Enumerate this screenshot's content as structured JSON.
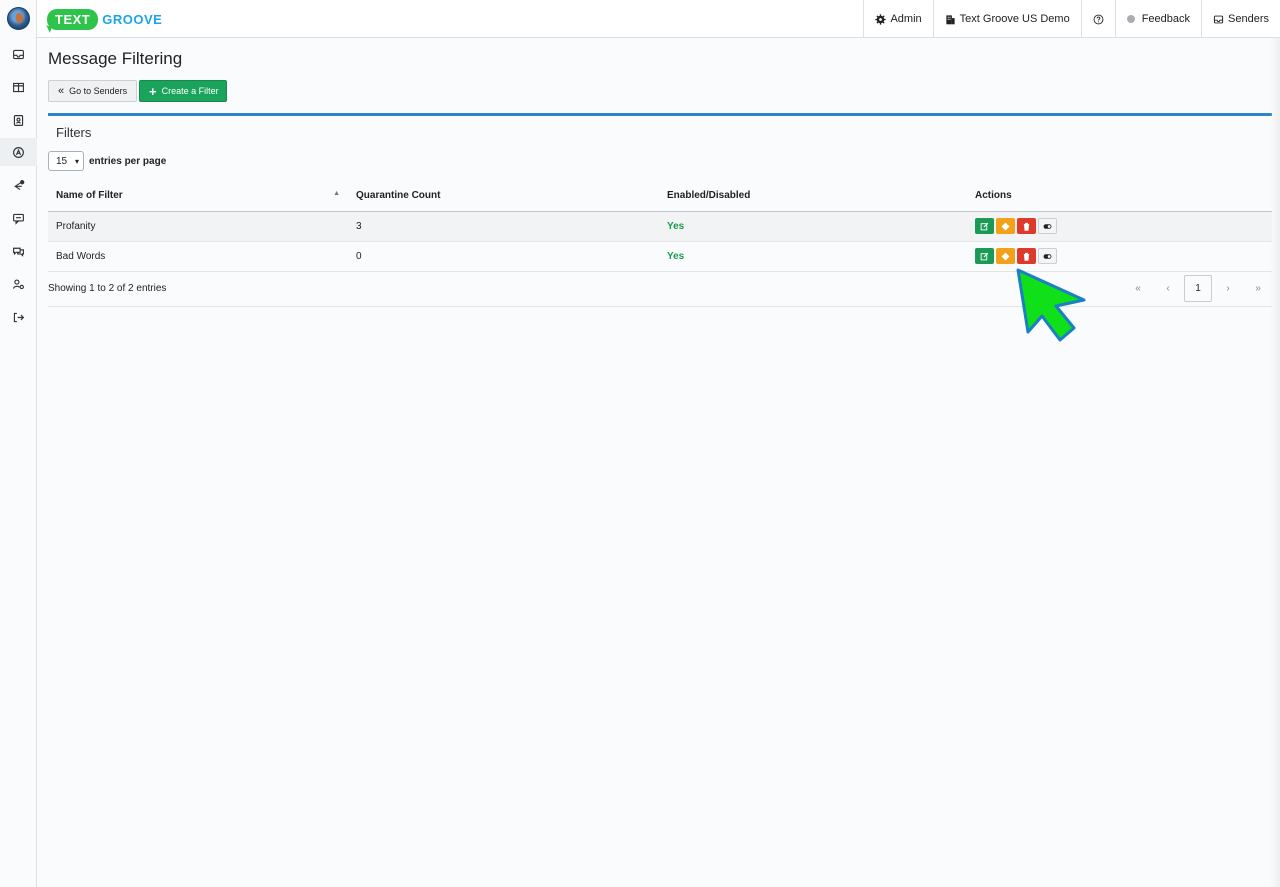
{
  "brand": {
    "word1": "TEXT",
    "word2": "GROOVE"
  },
  "topnav": {
    "admin": "Admin",
    "account": "Text Groove US Demo",
    "feedback": "Feedback",
    "senders": "Senders"
  },
  "sidebar": {
    "items": [
      "inbox-icon",
      "columns-icon",
      "contacts-icon",
      "compass-icon",
      "send-settings-icon",
      "chat-icon",
      "conversations-icon",
      "user-settings-icon",
      "logout-icon"
    ]
  },
  "page": {
    "title": "Message Filtering",
    "go_senders": "Go to Senders",
    "create_filter": "Create a Filter"
  },
  "panel": {
    "title": "Filters",
    "per_page_value": "15",
    "per_page_label": "entries per page",
    "columns": [
      "Name of Filter",
      "Quarantine Count",
      "Enabled/Disabled",
      "Actions"
    ],
    "rows": [
      {
        "name": "Profanity",
        "count": "3",
        "enabled": "Yes"
      },
      {
        "name": "Bad Words",
        "count": "0",
        "enabled": "Yes"
      }
    ],
    "showing": "Showing 1 to 2 of 2 entries",
    "pager": {
      "first": "«",
      "prev": "‹",
      "page": "1",
      "next": "›",
      "last": "»"
    }
  },
  "colors": {
    "accent_green": "#1aa35a",
    "panel_border": "#2d86c9",
    "yes_green": "#1a9a4e",
    "arrow_green": "#16e01c"
  }
}
